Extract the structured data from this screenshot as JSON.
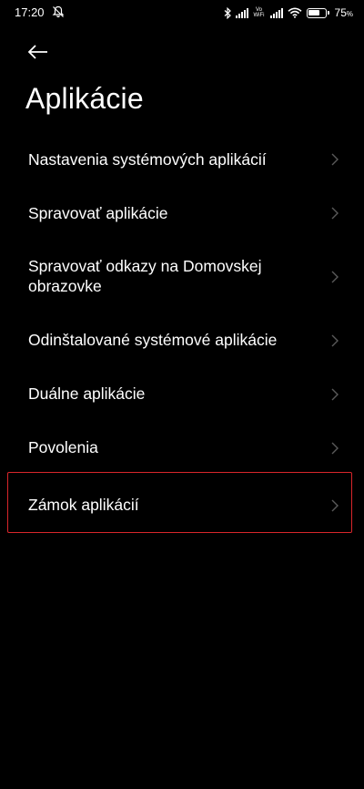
{
  "status_bar": {
    "time": "17:20",
    "volte_line1": "Vo",
    "volte_line2": "WiFi",
    "battery_percent": "75",
    "battery_suffix": "%",
    "battery_level": 0.75,
    "icons": [
      "mute-icon",
      "bluetooth-icon",
      "signal-icon",
      "volte-wifi-icon",
      "signal-icon",
      "wifi-icon",
      "battery-icon"
    ]
  },
  "header": {
    "back_icon": "back-arrow-icon",
    "title": "Aplikácie"
  },
  "menu": {
    "items": [
      {
        "label": "Nastavenia systémových aplikácií"
      },
      {
        "label": "Spravovať aplikácie"
      },
      {
        "label": "Spravovať odkazy na Domovskej obrazovke"
      },
      {
        "label": "Odinštalované systémové aplikácie"
      },
      {
        "label": "Duálne aplikácie"
      },
      {
        "label": "Povolenia"
      },
      {
        "label": "Zámok aplikácií"
      }
    ]
  },
  "highlight": {
    "color": "#d9262b",
    "target": "Zámok aplikácií"
  }
}
